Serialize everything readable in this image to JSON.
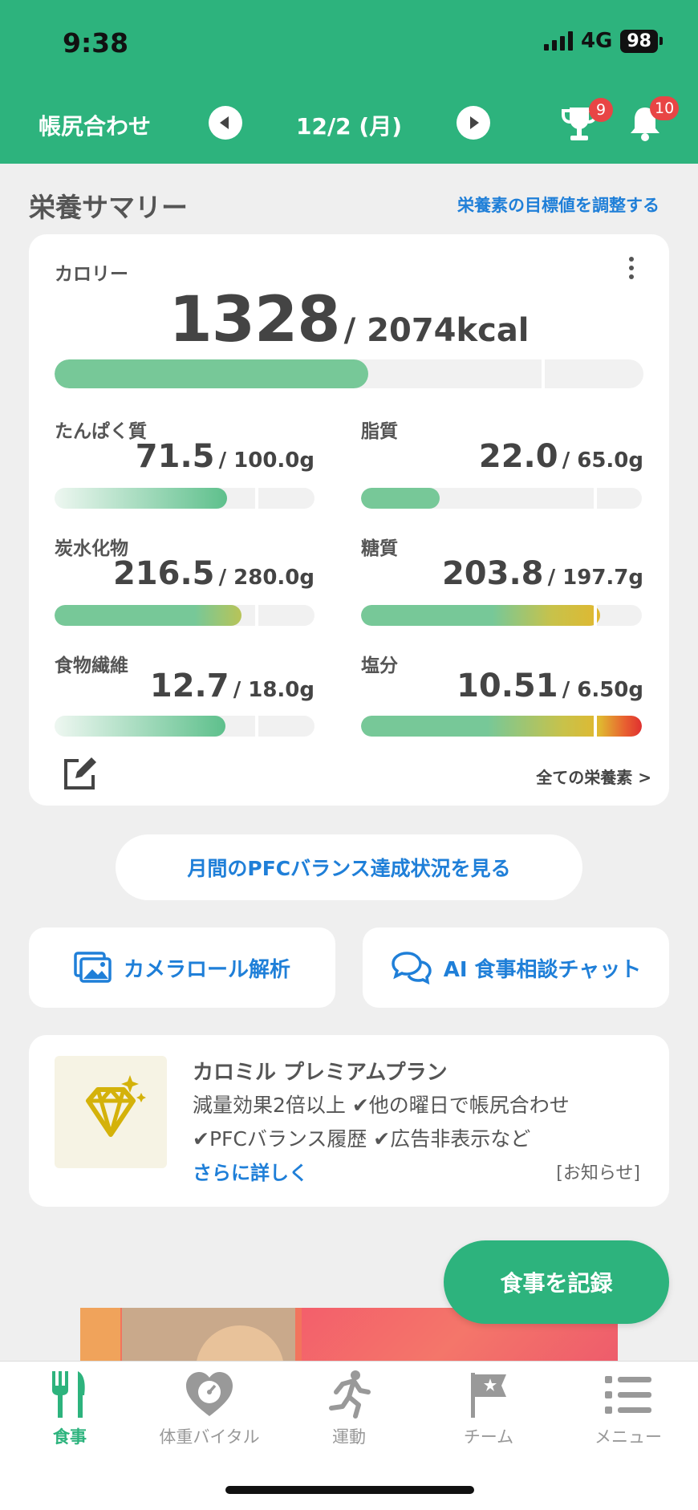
{
  "status": {
    "time": "9:38",
    "network": "4G",
    "battery": "98"
  },
  "nav": {
    "left_label": "帳尻合わせ",
    "date": "12/2 (月)",
    "trophy_badge": "9",
    "bell_badge": "10"
  },
  "summary": {
    "title": "栄養サマリー",
    "adjust_link": "栄養素の目標値を調整する",
    "calorie": {
      "label": "カロリー",
      "value": "1328",
      "target": "/ 2074kcal",
      "progress": 0.53
    },
    "nutrients": [
      {
        "name": "たんぱく質",
        "value": "71.5",
        "target": "/ 100.0g",
        "progress": 0.715
      },
      {
        "name": "脂質",
        "value": "22.0",
        "target": "/ 65.0g",
        "progress": 0.34
      },
      {
        "name": "炭水化物",
        "value": "216.5",
        "target": "/ 280.0g",
        "progress": 0.773
      },
      {
        "name": "糖質",
        "value": "203.8",
        "target": "/ 197.7g",
        "progress": 1.03
      },
      {
        "name": "食物繊維",
        "value": "12.7",
        "target": "/ 18.0g",
        "progress": 0.706
      },
      {
        "name": "塩分",
        "value": "10.51",
        "target": "/ 6.50g",
        "progress": 1.62
      }
    ],
    "all_nutrients_link": "全ての栄養素 >"
  },
  "pfc_button": "月間のPFCバランス達成状況を見る",
  "actions": {
    "camera_roll": "カメラロール解析",
    "ai_chat": "AI 食事相談チャット"
  },
  "promo": {
    "title": "カロミル プレミアムプラン",
    "line1": "減量効果2倍以上 ✔他の曜日で帳尻合わせ",
    "line2": "✔PFCバランス履歴 ✔広告非表示など",
    "more_link": "さらに詳しく",
    "info_tag": "[お知らせ]"
  },
  "fab_label": "食事を記録",
  "tabs": [
    {
      "label": "食事",
      "icon": "fork-knife-icon"
    },
    {
      "label": "体重バイタル",
      "icon": "heart-scale-icon"
    },
    {
      "label": "運動",
      "icon": "runner-icon"
    },
    {
      "label": "チーム",
      "icon": "flag-icon"
    },
    {
      "label": "メニュー",
      "icon": "menu-list-icon"
    }
  ],
  "colors": {
    "brand_green": "#2db37d",
    "link_blue": "#1f7fd8",
    "badge_red": "#e84545"
  }
}
